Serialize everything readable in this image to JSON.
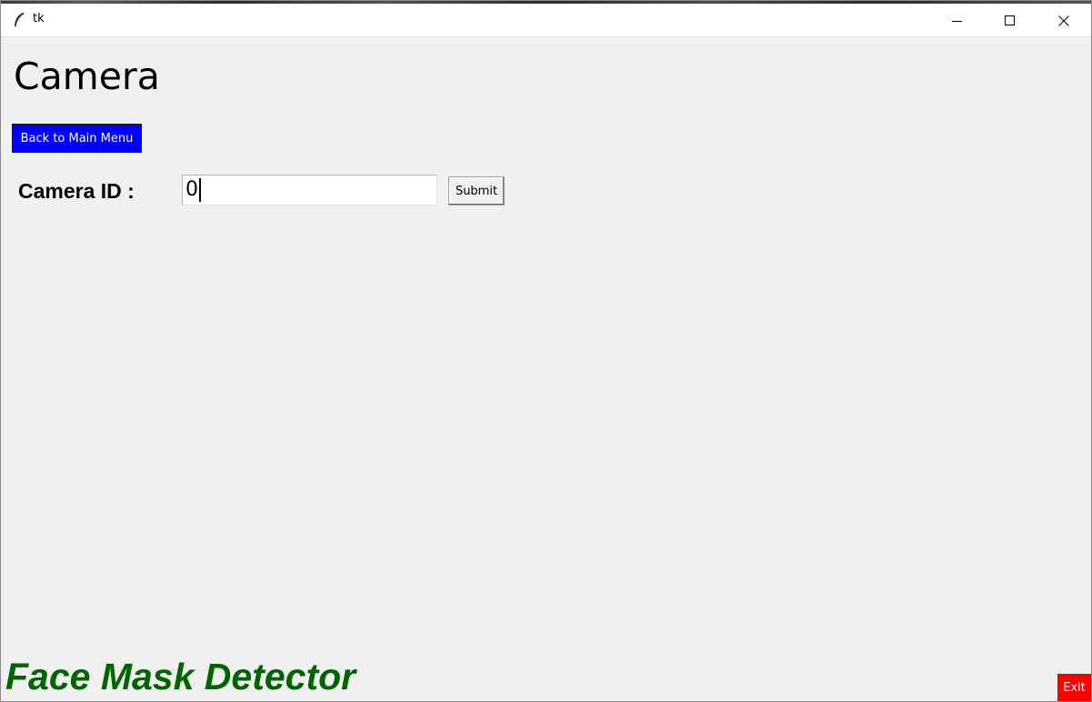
{
  "window": {
    "title": "tk",
    "icons": {
      "app": "feather-icon",
      "minimize": "minimize-icon",
      "maximize": "maximize-icon",
      "close": "close-icon"
    }
  },
  "page": {
    "title": "Camera",
    "back_button_label": "Back to Main Menu",
    "camera_id_label": "Camera ID :",
    "camera_id_value": "0",
    "submit_label": "Submit",
    "footer_title": "Face Mask Detector",
    "exit_label": "Exit"
  },
  "colors": {
    "back_button_bg": "#0000ff",
    "exit_button_bg": "#ff0000",
    "footer_title": "#006400",
    "window_bg": "#f0f0f0"
  }
}
